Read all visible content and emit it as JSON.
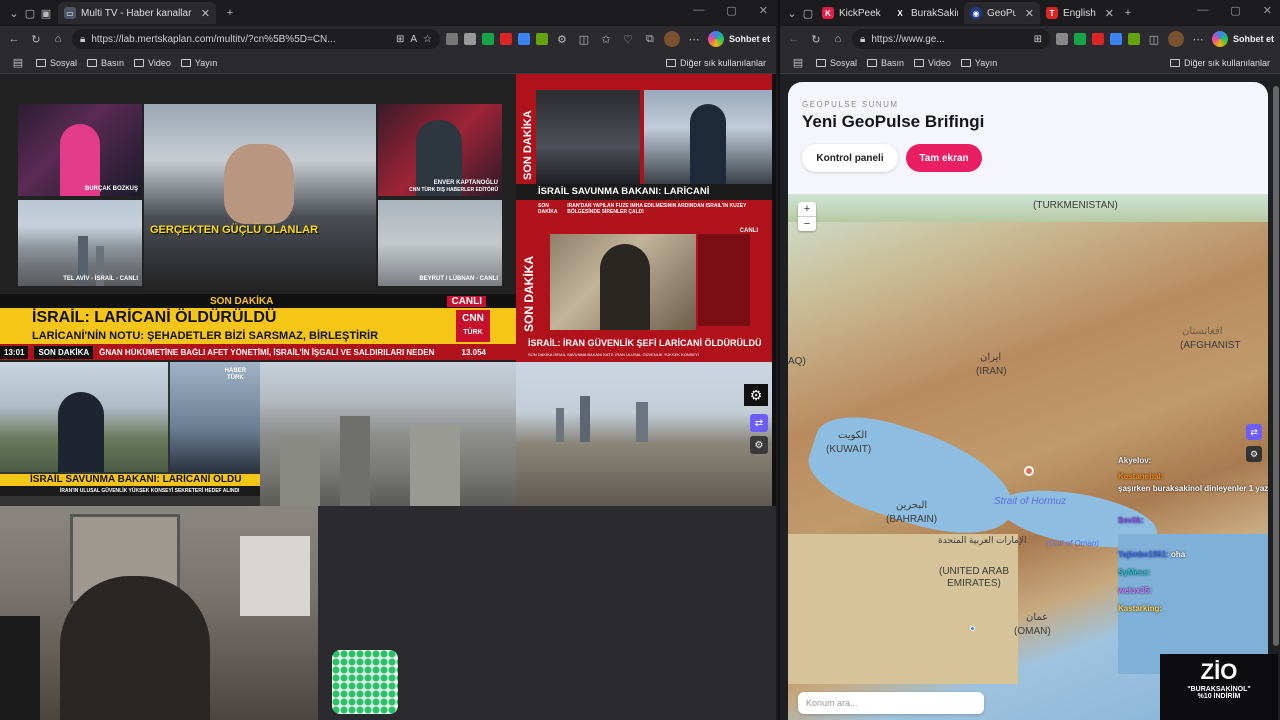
{
  "left_browser": {
    "tab_title": "Multi TV - Haber kanallarını aynı a",
    "url": "https://lab.mertskaplan.com/multitv/?cn%5B%5D=CN...",
    "copilot_label": "Sohbet et",
    "bookmarks": [
      "Sosyal",
      "Basın",
      "Video",
      "Yayın"
    ],
    "other_bookmarks": "Diğer sık kullanılanlar"
  },
  "right_browser": {
    "tabs": [
      "KickPeek -",
      "BurakSakin",
      "GeoPulse",
      "English - T"
    ],
    "url": "https://www.ge...",
    "copilot_label": "Sohbet et",
    "bookmarks": [
      "Sosyal",
      "Basın",
      "Video",
      "Yayın"
    ],
    "other_bookmarks": "Diğer sık kullanılanlar"
  },
  "tv": {
    "cnn": {
      "name_1": "BURÇAK BOZKUŞ",
      "name_2": "ENVER KAPTANOĞLU",
      "name_2_sub": "CNN TÜRK DIŞ HABERLER EDİTÖRÜ",
      "loc_1": "TEL AVİV - İSRAİL - CANLI",
      "loc_2": "BEYRUT / LÜBNAN - CANLI",
      "center_caption": "GERÇEKTEN GÜÇLÜ OLANLAR",
      "breaking": "SON DAKİKA",
      "live": "CANLI",
      "headline": "İSRAİL: LARİCANİ ÖLDÜRÜLDÜ",
      "subhead": "LARİCANİ'NİN NOTU: ŞEHADETLER BİZİ SARSMAZ, BİRLEŞTİRİR",
      "son_dakika": "SON DAKİKA",
      "ticker": "ĞNAN HÜKÜMETİNE BAĞLI AFET YÖNETİMİ, İSRAİL'İN İŞGALİ VE SALDIRILARI NEDEN",
      "time": "13:01",
      "index": "13.054",
      "logo_top": "CNN",
      "logo_bottom": "TÜRK"
    },
    "ntv": {
      "vertical": "SON DAKİKA",
      "headline": "İSRAİL SAVUNMA BAKANI: LARİCANİ ÖLDÜRÜLDÜ",
      "ticker_label": "SON DAKİKA",
      "ticker": "İRAN'DAN YAPILAN FÜZE İMHA EDİLMESİNİN ARDINDAN İSRAİL'İN KUZEY BÖLGESİNDE SİRENLER ÇALDI"
    },
    "szc": {
      "vertical": "SON DAKİKA",
      "live": "CANLI",
      "headline": "İSRAİL: İRAN GÜVENLİK ŞEFİ LARİCANİ ÖLDÜRÜLDÜ",
      "ticker": "SON DAKİKA  İSRAİL SAVUNMA BAKANI KATZ: İRAN ULUSAL GÜVENLİK YÜKSEK KONSEYİ"
    },
    "haberturk": {
      "logo_top": "HABER",
      "logo_bottom": "TÜRK",
      "headline": "İSRAİL SAVUNMA BAKANI: LARİCANİ ÖLDÜ",
      "ticker": "İRAN'IN ULUSAL GÜVENLİK YÜKSEK KONSEYİ SEKRETERİ HEDEF ALINDI"
    }
  },
  "geopulse": {
    "eyebrow": "GEOPULSE SUNUM",
    "title": "Yeni GeoPulse Brifingi",
    "btn_panel": "Kontrol paneli",
    "btn_fullscreen": "Tam ekran",
    "search_placeholder": "Konum ara...",
    "map_labels": {
      "turkmenistan": "(TURKMENISTAN)",
      "iran_native": "ایران",
      "iran": "(IRAN)",
      "afghanistan": "(AFGHANIST",
      "afghanistan_native": "افغانستان",
      "iraq": "AQ)",
      "kuwait_native": "الكويت",
      "kuwait": "(KUWAIT)",
      "bahrain_native": "البحرين",
      "bahrain": "(BAHRAIN)",
      "uae_native": "الإمارات العربية المتحدة",
      "uae": "(UNITED ARAB EMIRATES)",
      "oman_native": "عمان",
      "oman": "(OMAN)",
      "hormuz": "Strait of Hormuz",
      "gulf_oman": "(Gulf of Oman)"
    },
    "chat": [
      {
        "user": "Akyelov:",
        "msg": "",
        "color": "#f0f0f0"
      },
      {
        "user": "Kestanebal:",
        "msg": "şaşırken buraksakinol dinleyenler 1 yazsın",
        "color": "#ff8a00"
      },
      {
        "user": "Sevlik:",
        "msg": "",
        "color": "#8a4dff"
      },
      {
        "user": "Yajimbe1961:",
        "msg": "oha",
        "color": "#3a6cff"
      },
      {
        "user": "SyMess:",
        "msg": "",
        "color": "#21c4d4"
      },
      {
        "user": "welox35:",
        "msg": "",
        "color": "#c77dff"
      },
      {
        "user": "Kastarking:",
        "msg": "",
        "color": "#ffd23f"
      }
    ]
  },
  "promo": {
    "logo": "ZİO",
    "line1": "\"BURAKSAKİNOL\"",
    "line2": "%10 İNDİRİM"
  },
  "colors": {
    "accent_pink": "#e91e63",
    "cnn_red": "#c8102e",
    "ticker_yellow": "#f5c518"
  }
}
